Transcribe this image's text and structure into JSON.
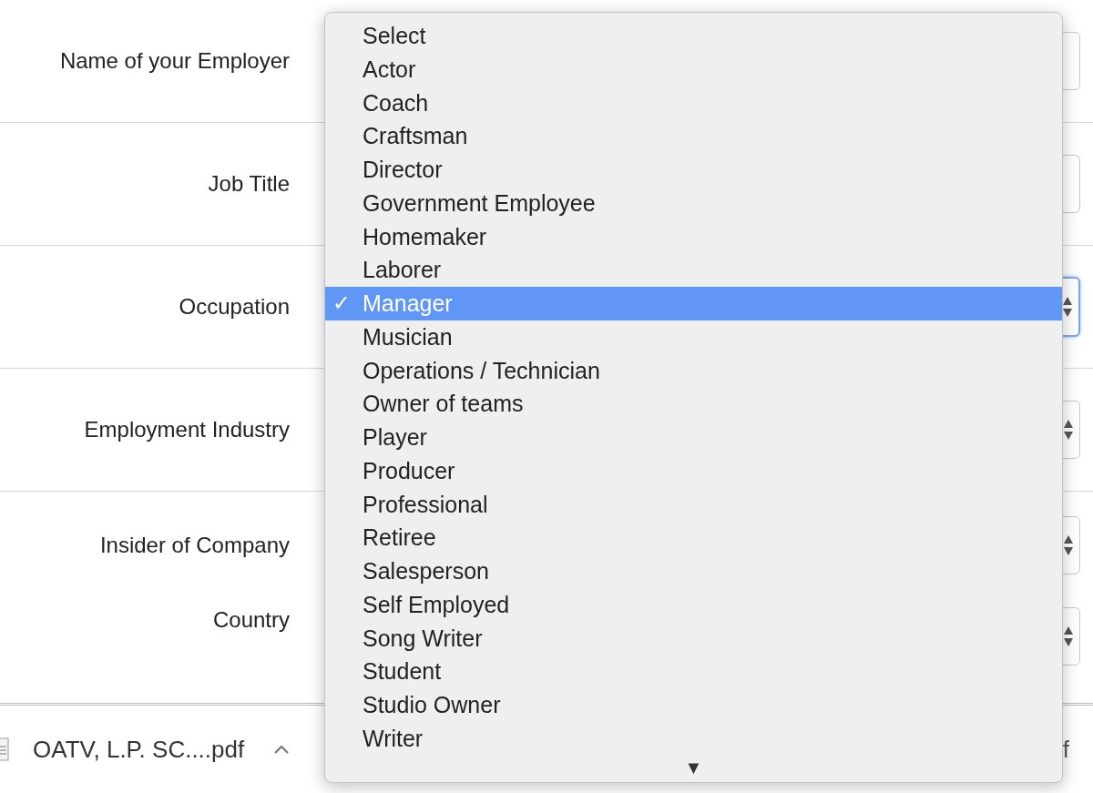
{
  "form_rows": [
    {
      "label": "Name of your Employer",
      "kind": "text",
      "focused": false,
      "divider": true
    },
    {
      "label": "Job Title",
      "kind": "text",
      "focused": false,
      "divider": true
    },
    {
      "label": "Occupation",
      "kind": "select",
      "focused": true,
      "divider": true
    },
    {
      "label": "Employment Industry",
      "kind": "select",
      "focused": false,
      "divider": true
    },
    {
      "label": "Insider of Company",
      "kind": "select",
      "focused": false,
      "divider": false
    },
    {
      "label": "Country",
      "kind": "select",
      "focused": false,
      "divider": false
    }
  ],
  "dropdown": {
    "options": [
      {
        "label": "Select",
        "selected": false
      },
      {
        "label": "Actor",
        "selected": false
      },
      {
        "label": "Coach",
        "selected": false
      },
      {
        "label": "Craftsman",
        "selected": false
      },
      {
        "label": "Director",
        "selected": false
      },
      {
        "label": "Government Employee",
        "selected": false
      },
      {
        "label": "Homemaker",
        "selected": false
      },
      {
        "label": "Laborer",
        "selected": false
      },
      {
        "label": "Manager",
        "selected": true
      },
      {
        "label": "Musician",
        "selected": false
      },
      {
        "label": "Operations / Technician",
        "selected": false
      },
      {
        "label": "Owner of teams",
        "selected": false
      },
      {
        "label": "Player",
        "selected": false
      },
      {
        "label": "Producer",
        "selected": false
      },
      {
        "label": "Professional",
        "selected": false
      },
      {
        "label": "Retiree",
        "selected": false
      },
      {
        "label": "Salesperson",
        "selected": false
      },
      {
        "label": "Self Employed",
        "selected": false
      },
      {
        "label": "Song Writer",
        "selected": false
      },
      {
        "label": "Student",
        "selected": false
      },
      {
        "label": "Studio Owner",
        "selected": false
      },
      {
        "label": "Writer",
        "selected": false
      }
    ],
    "check_mark": "✓",
    "scroll_arrow": "▼"
  },
  "download_bar": {
    "file_name": "OATV, L.P. SC....pdf",
    "right_text": "f"
  }
}
